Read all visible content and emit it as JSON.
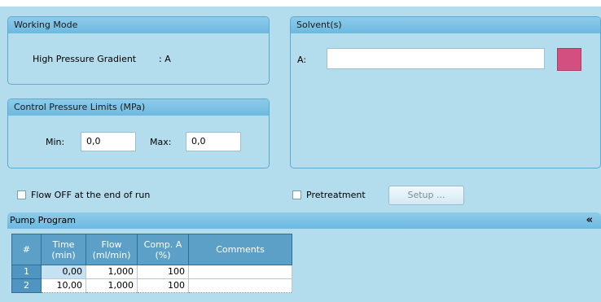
{
  "working_mode": {
    "title": "Working Mode",
    "mode_label": "High Pressure Gradient",
    "mode_value": ": A"
  },
  "solvents": {
    "title": "Solvent(s)",
    "a_label": "A:",
    "a_value": "",
    "a_color": "#d24f7f"
  },
  "pressure_limits": {
    "title": "Control Pressure Limits (MPa)",
    "min_label": "Min:",
    "min_value": "0,0",
    "max_label": "Max:",
    "max_value": "0,0"
  },
  "options": {
    "flow_off_label": "Flow OFF at the end of run",
    "flow_off_checked": false,
    "pretreatment_label": "Pretreatment",
    "pretreatment_checked": false,
    "setup_label": "Setup ..."
  },
  "pump_program": {
    "title": "Pump Program",
    "collapse_glyph": "«",
    "columns": [
      {
        "line1": "#",
        "line2": ""
      },
      {
        "line1": "Time",
        "line2": "(min)"
      },
      {
        "line1": "Flow",
        "line2": "(ml/min)"
      },
      {
        "line1": "Comp. A",
        "line2": "(%)"
      },
      {
        "line1": "Comments",
        "line2": ""
      }
    ],
    "rows": [
      {
        "num": "1",
        "time": "0,00",
        "flow": "1,000",
        "comp_a": "100",
        "comments": ""
      },
      {
        "num": "2",
        "time": "10,00",
        "flow": "1,000",
        "comp_a": "100",
        "comments": ""
      }
    ]
  }
}
